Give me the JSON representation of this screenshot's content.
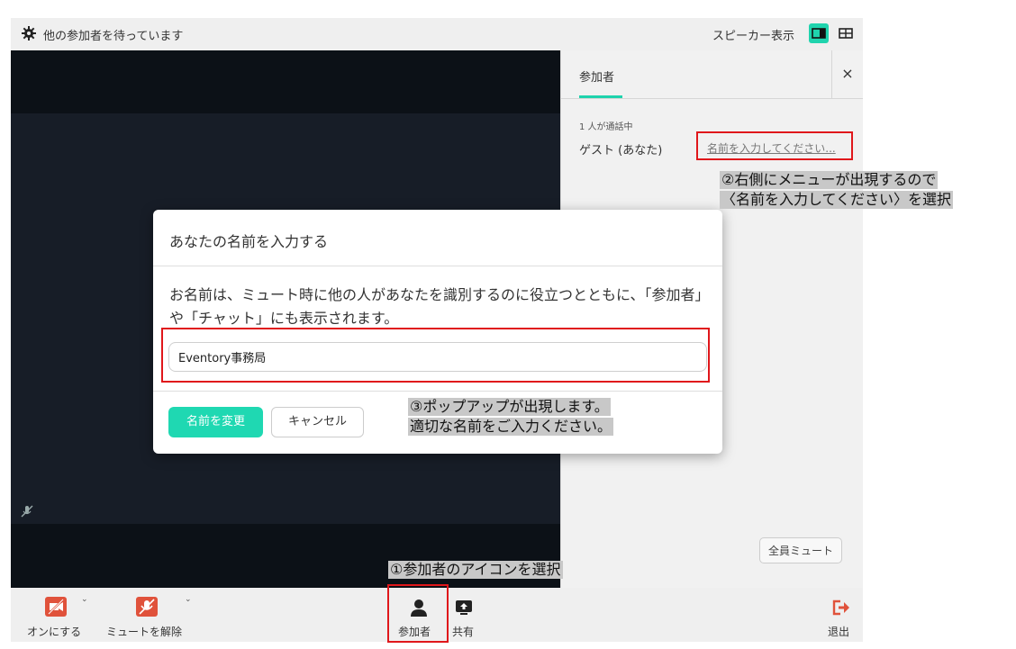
{
  "topbar": {
    "gear_icon": "gear-icon",
    "status": "他の参加者を待っています",
    "view_label": "スピーカー表示",
    "accent": "#1fd3ad"
  },
  "panel": {
    "tab": "参加者",
    "close": "×",
    "in_call": "1 人が通話中",
    "guest": "ゲスト (あなた)",
    "enter_name": "名前を入力してください...",
    "mute_all": "全員ミュート"
  },
  "modal": {
    "title": "あなたの名前を入力する",
    "description": "お名前は、ミュート時に他の人があなたを識別するのに役立つとともに、「参加者」や「チャット」にも表示されます。",
    "input_value": "Eventory事務局",
    "change_button": "名前を変更",
    "cancel_button": "キャンセル"
  },
  "toolbar": {
    "camera_label": "オンにする",
    "mic_label": "ミュートを解除",
    "participants_label": "参加者",
    "share_label": "共有",
    "leave_label": "退出",
    "caret": "⌄",
    "danger_color": "#e0523b"
  },
  "annotations": {
    "step1": "①参加者のアイコンを選択",
    "step2_line1": "②右側にメニューが出現するので",
    "step2_line2": "〈名前を入力してください〉を選択",
    "step3_line1": "③ポップアップが出現します。",
    "step3_line2": "適切な名前をご入力ください。",
    "highlight_color": "#e0171b"
  }
}
